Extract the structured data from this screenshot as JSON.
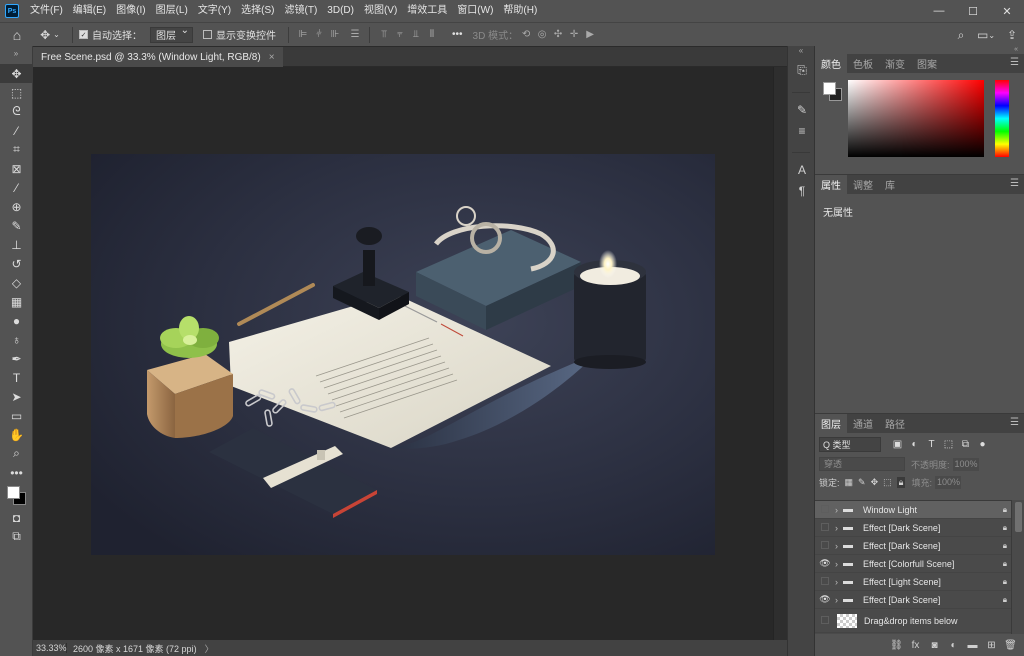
{
  "app": {
    "logo": "Ps"
  },
  "menu": [
    "文件(F)",
    "编辑(E)",
    "图像(I)",
    "图层(L)",
    "文字(Y)",
    "选择(S)",
    "滤镜(T)",
    "3D(D)",
    "视图(V)",
    "增效工具",
    "窗口(W)",
    "帮助(H)"
  ],
  "window_controls": {
    "minimize": "—",
    "maximize": "☐",
    "close": "✕"
  },
  "options": {
    "home_icon": "home-icon",
    "move_icon": "move-icon",
    "auto_select_label": "自动选择：",
    "auto_select_target": "图层",
    "show_transform_label": "显示变换控件",
    "more": "•••",
    "mode_3d_label": "3D 模式："
  },
  "document": {
    "tab_title": "Free Scene.psd @ 33.3% (Window Light, RGB/8)",
    "close": "×"
  },
  "status": {
    "zoom": "33.33%",
    "doc_info": "2600 像素 x 1671 像素 (72 ppi)",
    "arrow": "〉"
  },
  "color_panel": {
    "tabs": [
      "颜色",
      "色板",
      "渐变",
      "图案"
    ],
    "active_tab": 0,
    "foreground": "#ffffff",
    "background": "#1e1e1e"
  },
  "properties_panel": {
    "tabs": [
      "属性",
      "调整",
      "库"
    ],
    "active_tab": 0,
    "empty_text": "无属性"
  },
  "layers_panel": {
    "tabs": [
      "图层",
      "通道",
      "路径"
    ],
    "active_tab": 0,
    "filter_kind": "Q 类型",
    "blend_mode": "穿透",
    "opacity_label": "不透明度:",
    "opacity_value": "100%",
    "lock_label": "锁定:",
    "fill_label": "填充:",
    "fill_value": "100%",
    "layers": [
      {
        "name": "Window Light",
        "visible": false,
        "selected": true,
        "type": "group"
      },
      {
        "name": "Effect [Dark Scene]",
        "visible": false,
        "selected": false,
        "type": "group"
      },
      {
        "name": "Effect [Dark Scene]",
        "visible": false,
        "selected": false,
        "type": "group"
      },
      {
        "name": "Effect [Colorfull Scene]",
        "visible": true,
        "selected": false,
        "type": "group"
      },
      {
        "name": "Effect [Light Scene]",
        "visible": false,
        "selected": false,
        "type": "group"
      },
      {
        "name": "Effect [Dark Scene]",
        "visible": true,
        "selected": false,
        "type": "group"
      },
      {
        "name": "Drag&drop items below",
        "visible": false,
        "selected": false,
        "type": "layer"
      }
    ]
  }
}
